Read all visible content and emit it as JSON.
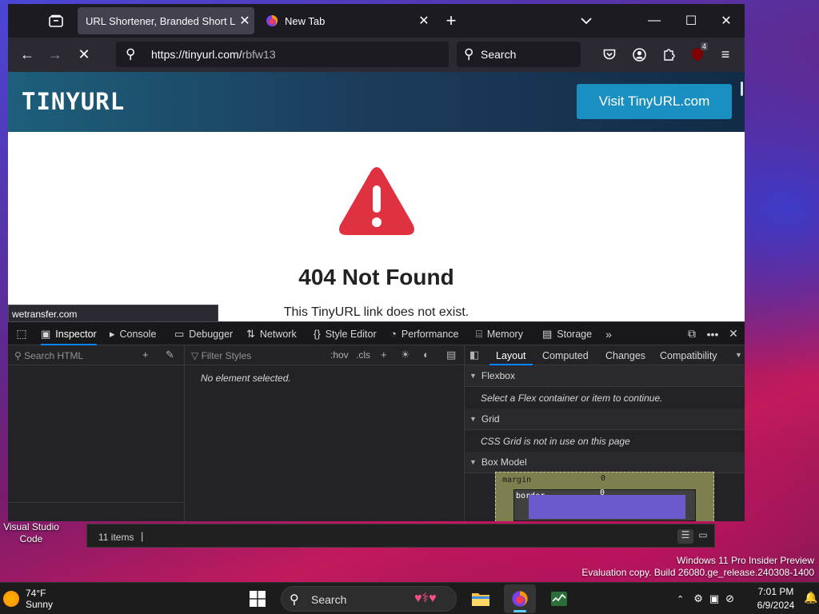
{
  "browser": {
    "tabs": [
      {
        "title": "URL Shortener, Branded Short Links & Analytics | TinyURL",
        "active": true
      },
      {
        "title": "New Tab",
        "active": false
      }
    ],
    "url_host": "https://tinyurl.com/",
    "url_path": "rbfw13",
    "search_placeholder": "Search",
    "extension_badge": "4"
  },
  "page": {
    "logo": "TINYURL",
    "visit_button": "Visit TinyURL.com",
    "heading": "404 Not Found",
    "subheading": "This TinyURL link does not exist.",
    "status_tooltip": "wetransfer.com"
  },
  "devtools": {
    "tabs": [
      {
        "label": "Inspector",
        "icon": "inspector-icon"
      },
      {
        "label": "Console",
        "icon": "console-icon"
      },
      {
        "label": "Debugger",
        "icon": "debugger-icon"
      },
      {
        "label": "Network",
        "icon": "network-icon"
      },
      {
        "label": "Style Editor",
        "icon": "style-editor-icon"
      },
      {
        "label": "Performance",
        "icon": "performance-icon"
      },
      {
        "label": "Memory",
        "icon": "memory-icon"
      },
      {
        "label": "Storage",
        "icon": "storage-icon"
      }
    ],
    "search_html_placeholder": "Search HTML",
    "filter_styles_placeholder": "Filter Styles",
    "hov": ":hov",
    "cls": ".cls",
    "no_element": "No element selected.",
    "layout_tabs": [
      "Layout",
      "Computed",
      "Changes",
      "Compatibility"
    ],
    "flexbox": {
      "title": "Flexbox",
      "message": "Select a Flex container or item to continue."
    },
    "grid": {
      "title": "Grid",
      "message": "CSS Grid is not in use on this page"
    },
    "box_model": {
      "title": "Box Model",
      "margin_label": "margin",
      "margin_value": "0",
      "border_label": "border",
      "border_value": "0"
    }
  },
  "background_window": {
    "items": "11 items"
  },
  "desktop": {
    "icon_label": "Visual Studio Code",
    "watermark_line1": "Windows 11 Pro Insider Preview",
    "watermark_line2": "Evaluation copy. Build 26080.ge_release.240308-1400"
  },
  "taskbar": {
    "weather_temp": "74°F",
    "weather_desc": "Sunny",
    "search_label": "Search",
    "time": "7:01 PM",
    "date": "6/9/2024"
  },
  "colors": {
    "accent": "#0a84ff",
    "tinyurl_button": "#1a8fc2",
    "warning_red": "#e03140"
  }
}
